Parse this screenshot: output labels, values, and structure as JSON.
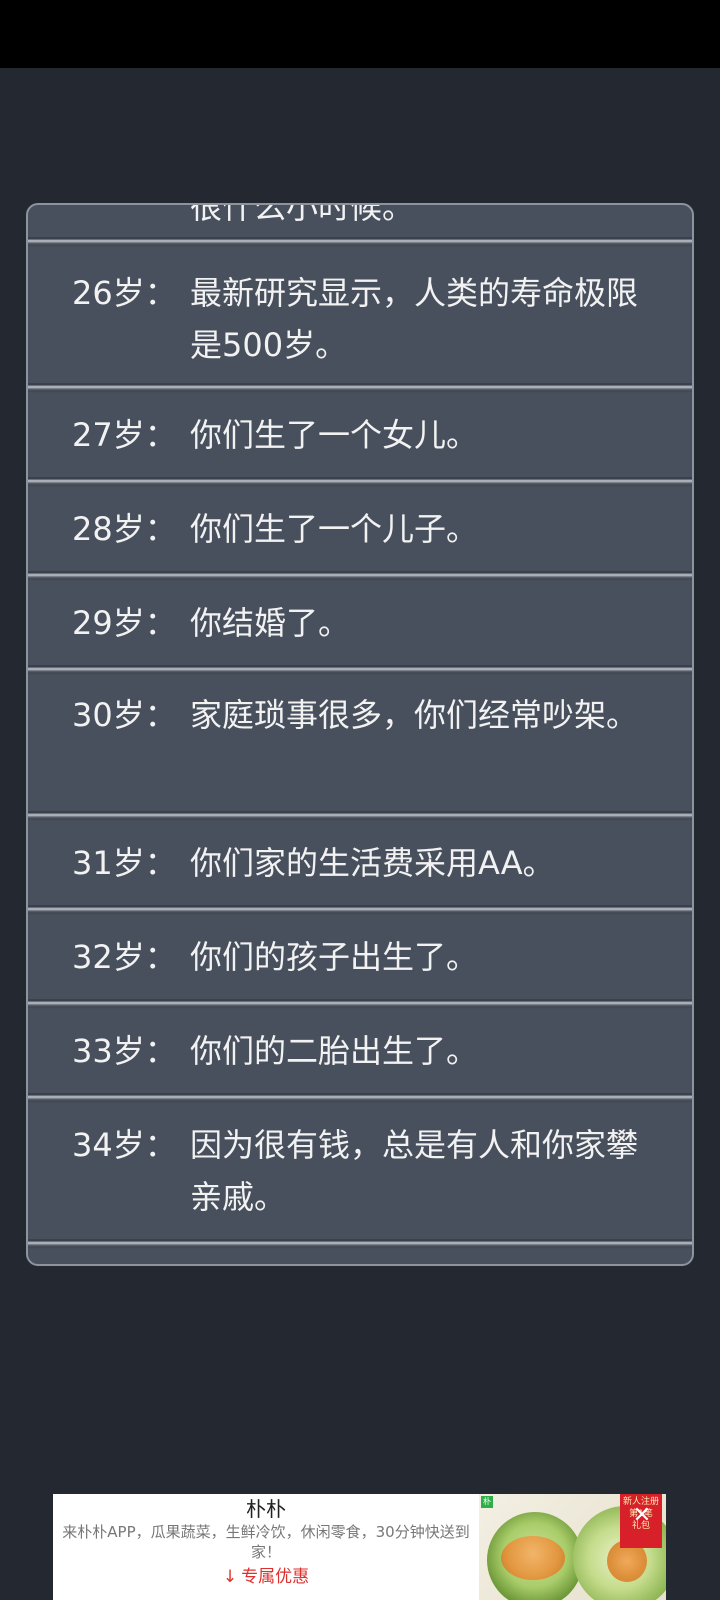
{
  "log": {
    "partial_top": "很什么小时候。",
    "entries": [
      {
        "age": "26岁：",
        "event": "最新研究显示，人类的寿命极限是500岁。"
      },
      {
        "age": "27岁：",
        "event": "你们生了一个女儿。"
      },
      {
        "age": "28岁：",
        "event": "你们生了一个儿子。"
      },
      {
        "age": "29岁：",
        "event": "你结婚了。"
      },
      {
        "age": "30岁：",
        "event": "家庭琐事很多，你们经常吵架。"
      },
      {
        "age": "31岁：",
        "event": "你们家的生活费采用AA。"
      },
      {
        "age": "32岁：",
        "event": "你们的孩子出生了。"
      },
      {
        "age": "33岁：",
        "event": "你们的二胎出生了。"
      },
      {
        "age": "34岁：",
        "event": "因为很有钱，总是有人和你家攀亲戚。"
      }
    ]
  },
  "ad": {
    "title": "朴朴",
    "description": "来朴朴APP，瓜果蔬菜，生鲜冷饮，休闲零食，30分钟快送到家！",
    "cta_label": "专属优惠",
    "badge": "朴",
    "tag_text": "新人注册\n第1笔\n礼包",
    "close_glyph": "✕",
    "download_icon": "↓",
    "accent_color": "#e0302d"
  }
}
